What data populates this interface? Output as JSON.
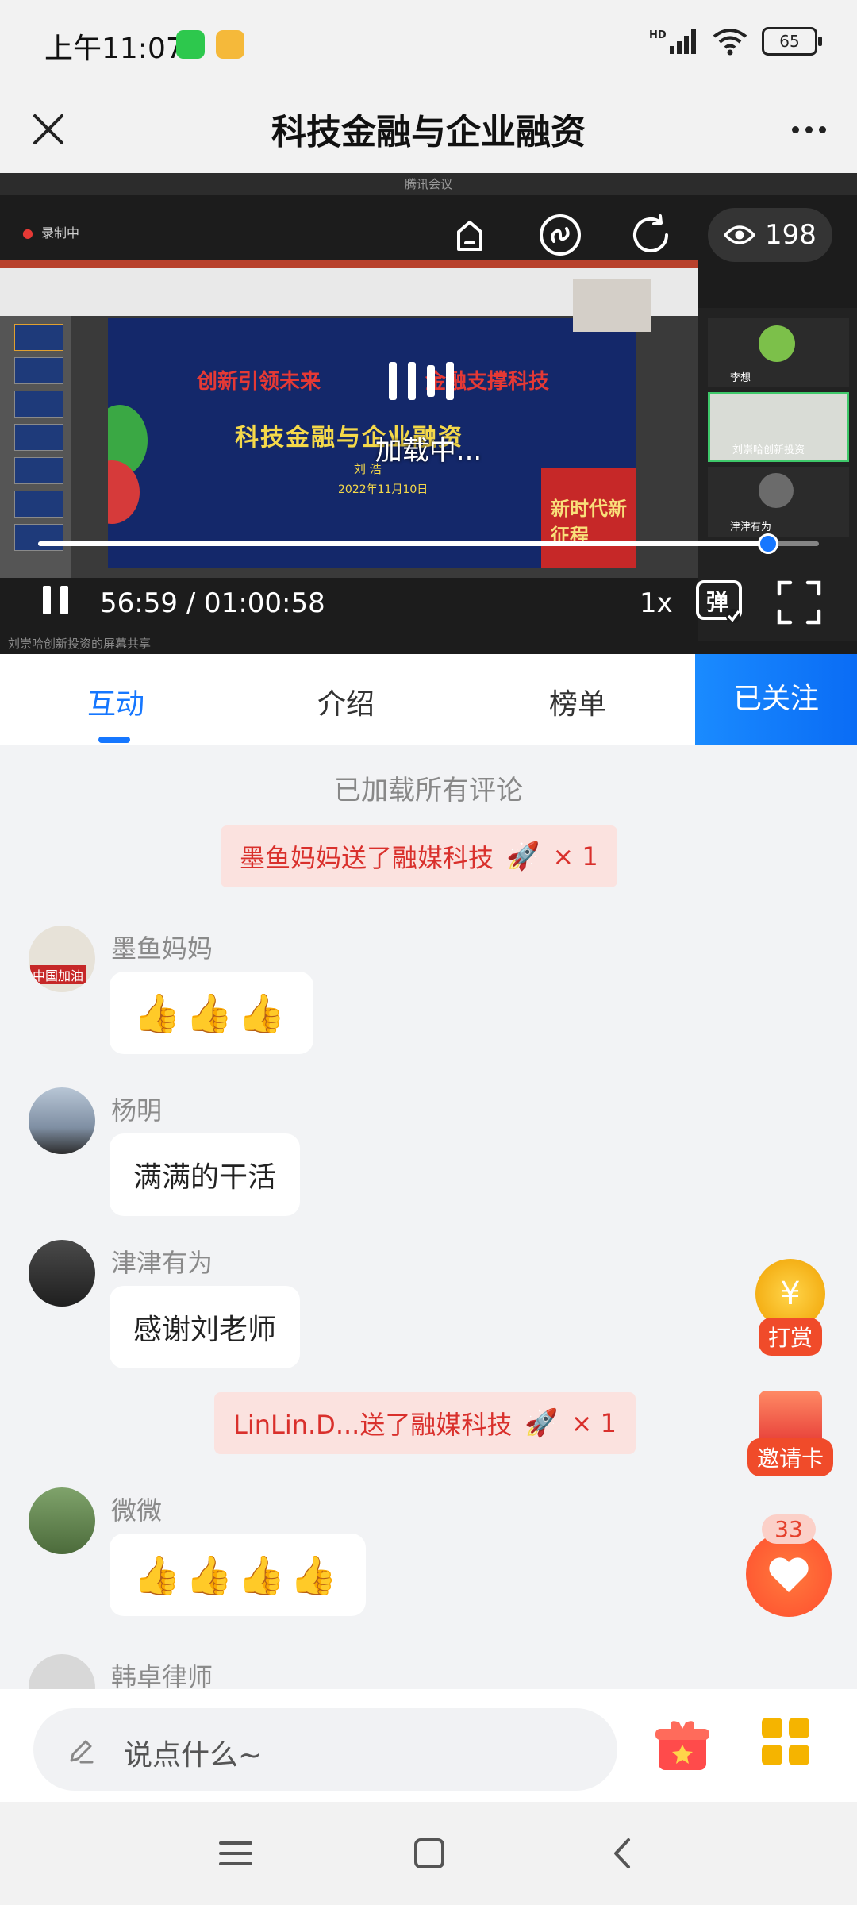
{
  "status_bar": {
    "time": "上午11:07",
    "network": "HD",
    "battery": "65"
  },
  "header": {
    "title": "科技金融与企业融资"
  },
  "video": {
    "window_title": "腾讯会议",
    "recording_label": "录制中",
    "view_count": "198",
    "loading_text": "加载中...",
    "current_time": "56:59",
    "duration": "01:00:58",
    "time_display": "56:59 / 01:00:58",
    "progress": 0.935,
    "speed": "1x",
    "danmaku_label": "弹",
    "share_caption": "刘崇哈创新投资的屏幕共享",
    "slide": {
      "line1_left": "创新引领未来",
      "line1_right": "金融支撑科技",
      "title": "科技金融与企业融资",
      "author": "刘 浩",
      "date": "2022年11月10日",
      "badge": "新时代新征程"
    },
    "participants": [
      "李想",
      "刘崇哈创新投资",
      "津津有为"
    ]
  },
  "tabs": [
    {
      "label": "互动",
      "active": true
    },
    {
      "label": "介绍",
      "active": false
    },
    {
      "label": "榜单",
      "active": false
    }
  ],
  "follow_button": "已关注",
  "chat": {
    "loaded_text": "已加载所有评论",
    "gift1": {
      "text": "墨鱼妈妈送了融媒科技",
      "count": "× 1"
    },
    "messages": [
      {
        "user": "墨鱼妈妈",
        "avatar_caption": "中国加油",
        "text": "👍👍👍"
      },
      {
        "user": "杨明",
        "text": "满满的干活"
      },
      {
        "user": "津津有为",
        "text": "感谢刘老师"
      },
      {
        "user": "微微",
        "text": "👍👍👍👍"
      },
      {
        "user": "韩卓律师",
        "text": ""
      }
    ],
    "gift2": {
      "text": "LinLin.D...送了融媒科技",
      "count": "× 1"
    }
  },
  "floating": {
    "reward_label": "打赏",
    "invite_label": "邀请卡",
    "like_count": "33"
  },
  "input": {
    "placeholder": "说点什么~"
  },
  "colors": {
    "accent": "#1677ff",
    "gift_bg": "#fbe2df",
    "gift_text": "#d9302c",
    "float_orange": "#f04b2a"
  }
}
